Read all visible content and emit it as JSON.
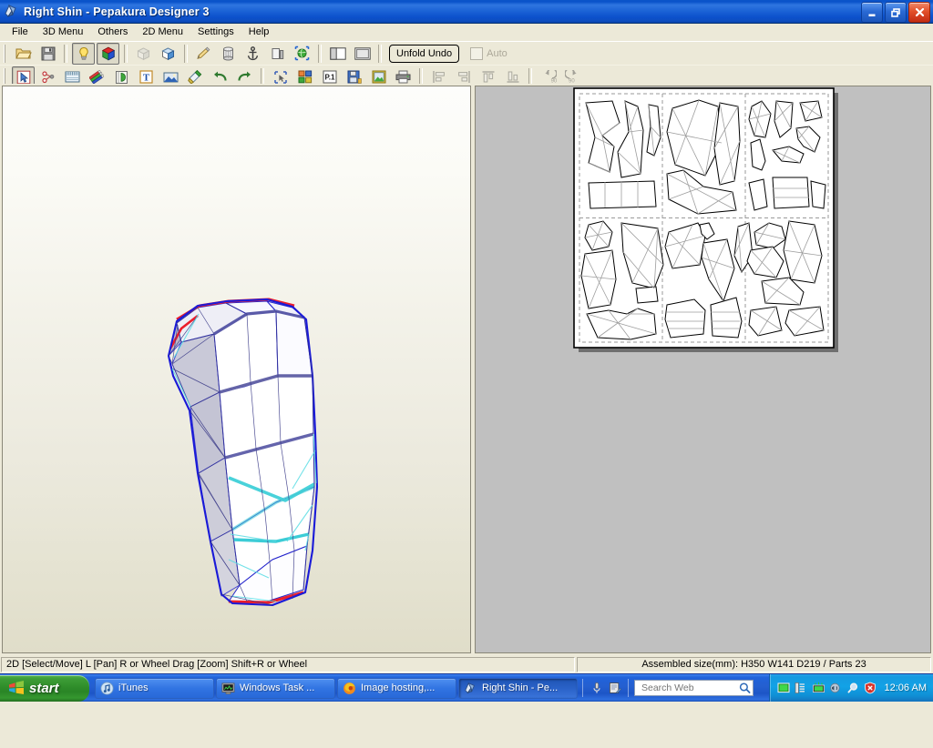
{
  "window": {
    "title": "Right Shin - Pepakura Designer 3",
    "icon": "pepakura-app-icon",
    "buttons": {
      "minimize": "Minimize",
      "maximize": "Restore",
      "close": "Close"
    }
  },
  "menubar": {
    "items": [
      {
        "label": "File",
        "accel": "F"
      },
      {
        "label": "3D Menu",
        "accel": "3"
      },
      {
        "label": "Others",
        "accel": "O"
      },
      {
        "label": "2D Menu",
        "accel": "2"
      },
      {
        "label": "Settings",
        "accel": "S"
      },
      {
        "label": "Help",
        "accel": "H"
      }
    ]
  },
  "toolbar_main": {
    "buttons": [
      {
        "name": "open-file-icon",
        "title": "Open"
      },
      {
        "name": "save-file-icon",
        "title": "Save"
      },
      {
        "name": "lightbulb-icon",
        "title": "Lighting",
        "active": true
      },
      {
        "name": "color-cube-icon",
        "title": "Texture / Color",
        "active": true
      },
      {
        "name": "gray-cube-icon",
        "title": "Flat Shading",
        "disabled": true
      },
      {
        "name": "blue-cube-icon",
        "title": "Shading"
      },
      {
        "name": "pencil-icon",
        "title": "Edit Edge"
      },
      {
        "name": "cylinder-icon",
        "title": "Extrude"
      },
      {
        "name": "anchor-icon",
        "title": "Anchor"
      },
      {
        "name": "flat-face-icon",
        "title": "Flat Face"
      },
      {
        "name": "green-globe-icon",
        "title": "Unfold"
      },
      {
        "name": "split-panel-vertical-icon",
        "title": "Split View"
      },
      {
        "name": "single-panel-icon",
        "title": "Single View"
      }
    ],
    "unfold_undo_label": "Unfold Undo",
    "auto_label": "Auto",
    "auto_checked": false,
    "auto_disabled": true
  },
  "toolbar_2d": {
    "buttons": [
      {
        "name": "select-arrow-icon",
        "title": "Select/Move",
        "active": true
      },
      {
        "name": "vertex-edge-icon",
        "title": "Edit Vertex"
      },
      {
        "name": "striped-band-icon",
        "title": "Flaps"
      },
      {
        "name": "markers-icon",
        "title": "Line Style"
      },
      {
        "name": "glue-tab-icon",
        "title": "Glue Tab"
      },
      {
        "name": "text-tool-icon",
        "title": "Text"
      },
      {
        "name": "image-tool-icon",
        "title": "Image"
      },
      {
        "name": "paint-tool-icon",
        "title": "Paint"
      },
      {
        "name": "undo-icon",
        "title": "Undo"
      },
      {
        "name": "redo-icon",
        "title": "Redo"
      },
      {
        "name": "select-region-icon",
        "title": "Select Region"
      },
      {
        "name": "layout-parts-icon",
        "title": "Layout Parts"
      },
      {
        "name": "page-number-icon",
        "title": "P.1 Page Setup"
      },
      {
        "name": "save-layout-icon",
        "title": "Save Layout"
      },
      {
        "name": "export-image-icon",
        "title": "Export Image"
      },
      {
        "name": "print-icon",
        "title": "Print"
      },
      {
        "name": "align-left-icon",
        "title": "Align Left",
        "disabled": true
      },
      {
        "name": "align-right-icon",
        "title": "Align Right",
        "disabled": true
      },
      {
        "name": "align-top-icon",
        "title": "Align Top",
        "disabled": true
      },
      {
        "name": "align-bottom-icon",
        "title": "Align Bottom",
        "disabled": true
      },
      {
        "name": "rotate-ccw-90-icon",
        "title": "Rotate 90 CCW",
        "disabled": true
      },
      {
        "name": "rotate-cw-90-icon",
        "title": "Rotate 90 CW",
        "disabled": true
      }
    ]
  },
  "statusbar": {
    "hint": "2D [Select/Move] L [Pan] R or Wheel Drag [Zoom] Shift+R or Wheel",
    "assembled": "Assembled size(mm): H350 W141 D219 / Parts 23"
  },
  "taskbar": {
    "start_label": "start",
    "items": [
      {
        "label": "iTunes",
        "icon": "itunes-icon",
        "active": false
      },
      {
        "label": "Windows Task ...",
        "icon": "task-manager-icon",
        "active": false
      },
      {
        "label": "Image hosting,...",
        "icon": "firefox-icon",
        "active": false
      },
      {
        "label": "Right Shin - Pe...",
        "icon": "pepakura-app-icon",
        "active": true
      }
    ],
    "quicklaunch": [
      {
        "name": "microphone-icon"
      },
      {
        "name": "notepad-pen-icon"
      }
    ],
    "search": {
      "placeholder": "Search Web",
      "value": "",
      "button_icon": "magnifier-icon"
    },
    "tray": [
      {
        "name": "green-monitor-icon"
      },
      {
        "name": "media-list-icon"
      },
      {
        "name": "network-monitor-icon"
      },
      {
        "name": "volume-icon"
      },
      {
        "name": "magnifier-icon"
      },
      {
        "name": "security-shield-icon"
      }
    ],
    "clock": "12:06 AM"
  },
  "panel_3d": {
    "name": "3D model view",
    "model": "Right shin armor low-poly mesh",
    "edge_colors": {
      "cut": "#e8112d",
      "mountain": "#2020d8",
      "valley": "#35d0d8",
      "face": "#ffffff",
      "shade": "#9a9ab8"
    }
  },
  "panel_2d": {
    "name": "2D unfold / papercraft layout",
    "page_background": "#ffffff",
    "view_background": "#c0c0c0",
    "grid_cols": 3,
    "grid_rows": 2,
    "line_color": "#000000",
    "fold_line_color": "#a6a6a6",
    "page_border_color": "#000000"
  }
}
